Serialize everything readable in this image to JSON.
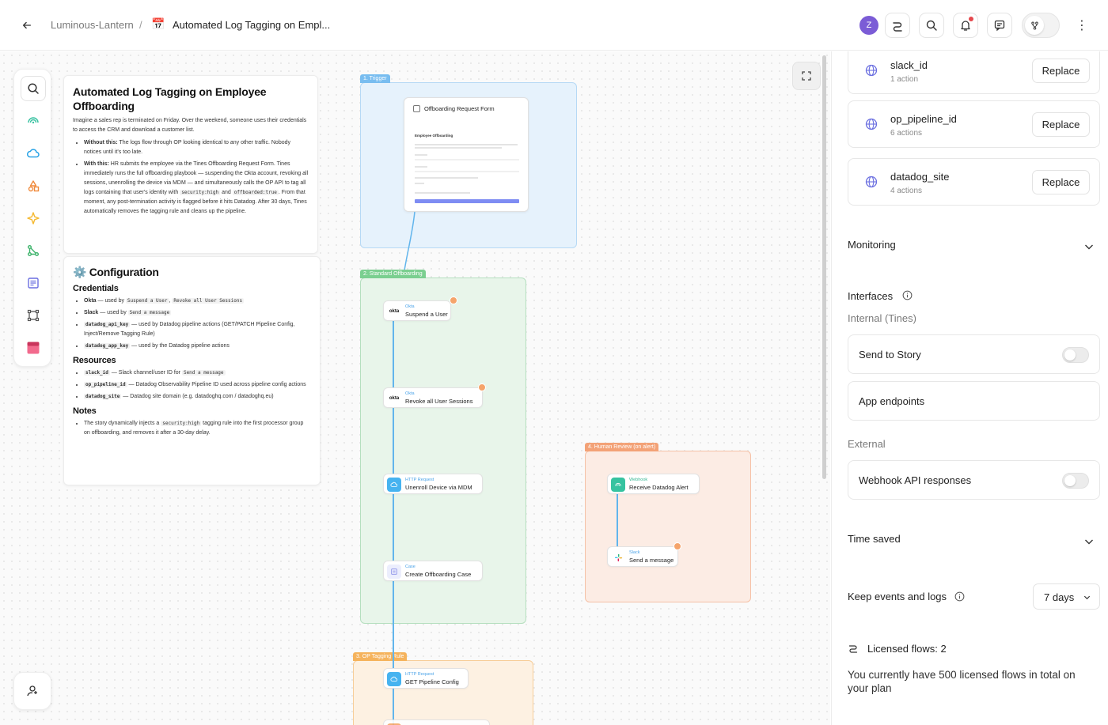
{
  "header": {
    "breadcrumb_team": "Luminous-Lantern",
    "breadcrumb_sep": "/",
    "story_emoji": "📅",
    "story_title": "Automated Log Tagging on Empl...",
    "avatar_letter": "Z"
  },
  "note_overview": {
    "title": "Automated Log Tagging on Employee Offboarding",
    "intro": "Imagine a sales rep is terminated on Friday. Over the weekend, someone uses their credentials to access the CRM and download a customer list.",
    "without_label": "Without this:",
    "without_text": " The logs flow through OP looking identical to any other traffic. Nobody notices until it's too late.",
    "with_label": "With this:",
    "with_text_1": " HR submits the employee via the Tines Offboarding Request Form. Tines immediately runs the full offboarding playbook — suspending the Okta account, revoking all sessions, unenrolling the device via MDM — and simultaneously calls the OP API to tag all logs containing that user's identity with ",
    "with_code_1": "security:high",
    "with_text_2": " and ",
    "with_code_2": "offboarded:true",
    "with_text_3": ". From that moment, any post-termination activity is flagged before it hits Datadog. After 30 days, Tines automatically removes the tagging rule and cleans up the pipeline."
  },
  "note_config": {
    "title": "⚙️ Configuration",
    "credentials_heading": "Credentials",
    "cred_okta_label": "Okta",
    "cred_okta_text": " — used by ",
    "cred_okta_code1": "Suspend a User",
    "cred_okta_comma": ", ",
    "cred_okta_code2": "Revoke all User Sessions",
    "cred_slack_label": "Slack",
    "cred_slack_text": " — used by ",
    "cred_slack_code": "Send a message",
    "cred_ddapi_code": "datadog_api_key",
    "cred_ddapi_text": " — used by Datadog pipeline actions (GET/PATCH Pipeline Config, Inject/Remove Tagging Rule)",
    "cred_ddapp_code": "datadog_app_key",
    "cred_ddapp_text": " — used by the Datadog pipeline actions",
    "resources_heading": "Resources",
    "res_slack_code": "slack_id",
    "res_slack_text": " — Slack channel/user ID for ",
    "res_slack_code2": "Send a message",
    "res_pipe_code": "op_pipeline_id",
    "res_pipe_text": " — Datadog Observability Pipeline ID used across pipeline config actions",
    "res_site_code": "datadog_site",
    "res_site_text": " — Datadog site domain (e.g. datadoghq.com / datadoghq.eu)",
    "notes_heading": "Notes",
    "notes_text_1": "The story dynamically injects a ",
    "notes_code": "security:high",
    "notes_text_2": " tagging rule into the first processor group on offboarding, and removes it after a 30-day delay."
  },
  "groups": {
    "trigger": "1. Trigger",
    "standard": "2. Standard Offboarding",
    "review": "4. Human Review (on alert)",
    "tagging": "3. OP Tagging Rule"
  },
  "form_card": {
    "title": "Offboarding Request Form",
    "subtitle": "Employee Offboarding"
  },
  "actions": [
    {
      "kind": "Okta",
      "name": "Suspend a User",
      "icon": "okta"
    },
    {
      "kind": "Okta",
      "name": "Revoke all User Sessions",
      "icon": "okta"
    },
    {
      "kind": "HTTP Request",
      "name": "Unenroll Device via MDM",
      "icon": "cloud"
    },
    {
      "kind": "Case",
      "name": "Create Offboarding Case",
      "icon": "case"
    },
    {
      "kind": "Webhook",
      "name": "Receive Datadog Alert",
      "icon": "webhook"
    },
    {
      "kind": "Slack",
      "name": "Send a message",
      "icon": "slack"
    },
    {
      "kind": "HTTP Request",
      "name": "GET Pipeline Config",
      "icon": "cloud"
    }
  ],
  "panel": {
    "resources": [
      {
        "name": "slack_id",
        "sub": "1 action",
        "button": "Replace"
      },
      {
        "name": "op_pipeline_id",
        "sub": "6 actions",
        "button": "Replace"
      },
      {
        "name": "datadog_site",
        "sub": "4 actions",
        "button": "Replace"
      }
    ],
    "monitoring": "Monitoring",
    "interfaces": "Interfaces",
    "internal_label": "Internal (Tines)",
    "send_to_story": "Send to Story",
    "app_endpoints": "App endpoints",
    "external_label": "External",
    "webhook_responses": "Webhook API responses",
    "time_saved": "Time saved",
    "keep_events": "Keep events and logs",
    "keep_value": "7 days",
    "licensed_flows": "Licensed flows: 2",
    "licensed_desc": "You currently have 500 licensed flows in total on your plan"
  },
  "colors": {
    "accent": "#7b5cd6",
    "wire": "#62b5ec",
    "trigger_bg": "#e6f2fc",
    "standard_bg": "#e8f5ea",
    "review_bg": "#fcece4",
    "tagging_bg": "#fdf1e2"
  }
}
